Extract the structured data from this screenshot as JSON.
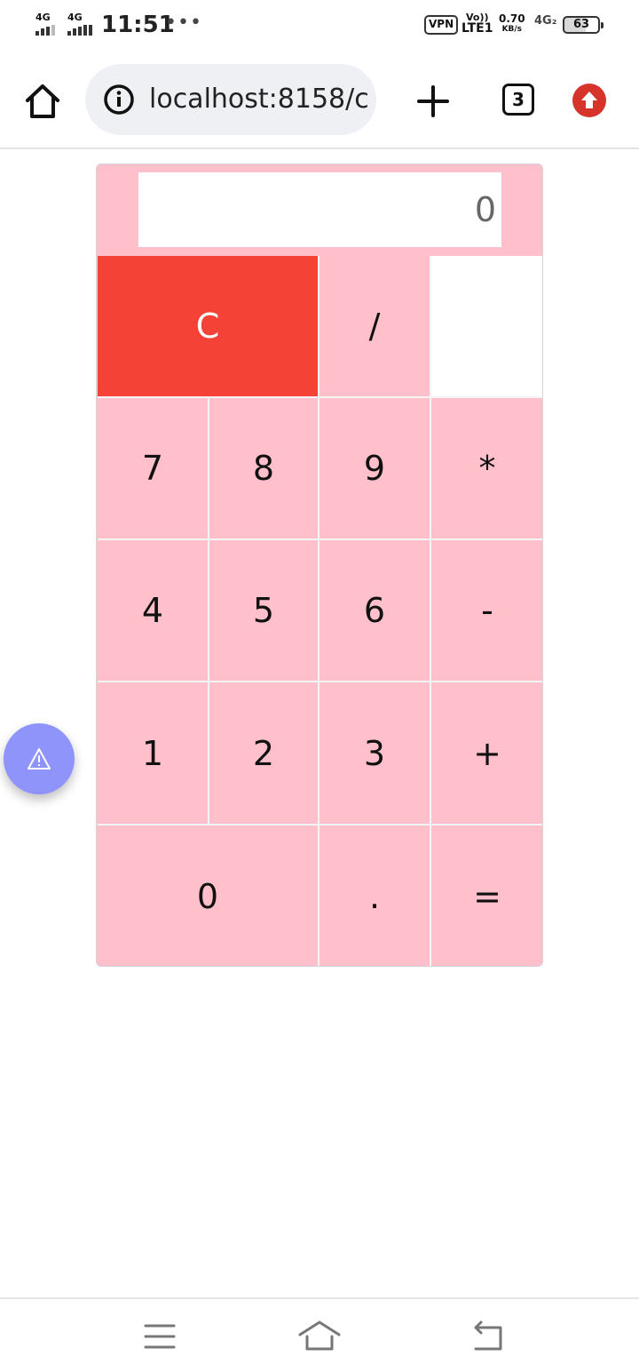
{
  "status_bar": {
    "sim1_network": "4G",
    "sim2_network": "4G",
    "time": "11:51",
    "overflow_dots": "•••",
    "vpn": "VPN",
    "volte_top": "Vo))",
    "volte_bottom": "LTE1",
    "speed_value": "0.70",
    "speed_unit": "KB/s",
    "network_type": "4G₂",
    "battery_level": "63"
  },
  "browser": {
    "url": "localhost:8158/c",
    "tab_count": "3"
  },
  "calculator": {
    "display": "0",
    "keys": {
      "clear": "C",
      "divide": "/",
      "seven": "7",
      "eight": "8",
      "nine": "9",
      "multiply": "*",
      "four": "4",
      "five": "5",
      "six": "6",
      "subtract": "-",
      "one": "1",
      "two": "2",
      "three": "3",
      "add": "+",
      "zero": "0",
      "decimal": ".",
      "equals": "="
    }
  },
  "floating_button": {
    "icon": "⚠"
  },
  "colors": {
    "calculator_bg": "#ffc0cb",
    "clear_key": "#f44336",
    "fab": "#8f94fb",
    "update_badge": "#d6332a"
  }
}
